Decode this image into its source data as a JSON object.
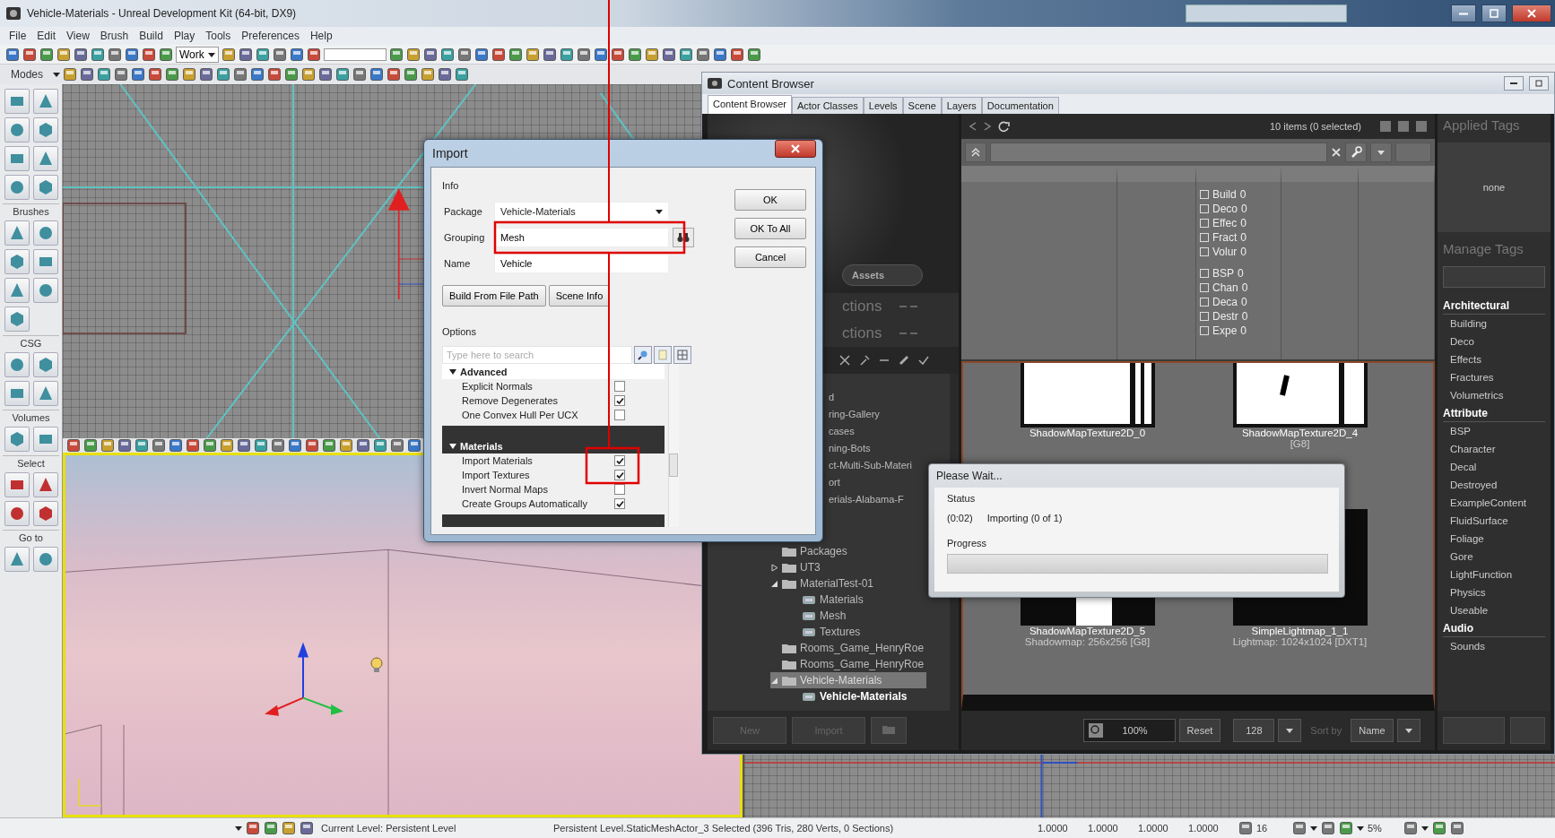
{
  "main_window": {
    "title": "Vehicle-Materials - Unreal Development Kit (64-bit, DX9)"
  },
  "menu": [
    "File",
    "Edit",
    "View",
    "Brush",
    "Build",
    "Play",
    "Tools",
    "Preferences",
    "Help"
  ],
  "toolbar": {
    "layout": "Work"
  },
  "modes_bar": {
    "label": "Modes"
  },
  "sidebar": {
    "sections": [
      "Brushes",
      "CSG",
      "Volumes",
      "Select",
      "Go to"
    ]
  },
  "content_browser": {
    "title": "Content Browser",
    "tabs": [
      {
        "label": "Content Browser",
        "selected": true
      },
      {
        "label": "Actor Classes",
        "selected": false
      },
      {
        "label": "Levels",
        "selected": false
      },
      {
        "label": "Scene",
        "selected": false
      },
      {
        "label": "Layers",
        "selected": false
      },
      {
        "label": "Documentation",
        "selected": false
      }
    ],
    "sources": {
      "assets_button": "Assets",
      "collection_headers": [
        "ctions",
        "ctions"
      ],
      "covered_items": [
        "d",
        "ring-Gallery",
        "cases",
        "ning-Bots",
        "ct-Multi-Sub-Materi",
        "ort",
        "erials-Alabama-F"
      ],
      "tree": [
        {
          "label": "Packages",
          "selected": false,
          "current": false
        },
        {
          "label": "UT3",
          "expanded": false,
          "selected": false,
          "current": false
        },
        {
          "label": "MaterialTest-01",
          "expanded": true,
          "selected": false,
          "current": false,
          "children": [
            {
              "label": "Materials",
              "selected": false,
              "current": false
            },
            {
              "label": "Mesh",
              "selected": false,
              "current": false
            },
            {
              "label": "Textures",
              "selected": false,
              "current": false
            }
          ]
        },
        {
          "label": "Rooms_Game_HenryRoe",
          "selected": false,
          "current": false
        },
        {
          "label": "Rooms_Game_HenryRoe",
          "selected": false,
          "current": false
        },
        {
          "label": "Vehicle-Materials",
          "expanded": true,
          "selected": true,
          "current": false,
          "children": [
            {
              "label": "Vehicle-Materials",
              "selected": false,
              "current": true
            }
          ]
        }
      ],
      "buttons": [
        "New",
        "Import"
      ]
    },
    "assets": {
      "count": "10 items (0 selected)",
      "tag_groups": [
        {
          "items": [
            {
              "label": "Build",
              "count": "0",
              "checked": false
            },
            {
              "label": "Deco",
              "count": "0",
              "checked": false
            },
            {
              "label": "Effec",
              "count": "0",
              "checked": false
            },
            {
              "label": "Fract",
              "count": "0",
              "checked": false
            },
            {
              "label": "Volur",
              "count": "0",
              "checked": false
            }
          ]
        },
        {
          "items": [
            {
              "label": "BSP",
              "count": "0",
              "checked": false
            },
            {
              "label": "Chan",
              "count": "0",
              "checked": false
            },
            {
              "label": "Deca",
              "count": "0",
              "checked": false
            },
            {
              "label": "Destr",
              "count": "0",
              "checked": false
            },
            {
              "label": "Expe",
              "count": "0",
              "checked": false
            }
          ]
        }
      ],
      "thumbnails": [
        {
          "name": "ShadowMapTexture2D_0"
        },
        {
          "name": "ShadowMapTexture2D_4",
          "info": "[G8]"
        },
        {
          "name": "ShadowMapTexture2D_5",
          "info": "Shadowmap: 256x256 [G8]"
        },
        {
          "name": "SimpleLightmap_1_1",
          "info": "Lightmap: 1024x1024 [DXT1]"
        }
      ],
      "zoom": "100%",
      "reset": "Reset",
      "thumb_size": "128",
      "sort_label": "Sort by",
      "sort_value": "Name"
    },
    "tags": {
      "applied_title": "Applied Tags",
      "applied_value": "none",
      "manage_title": "Manage Tags",
      "groups": [
        {
          "title": "Architectural",
          "tags": [
            "Building",
            "Deco",
            "Effects",
            "Fractures",
            "Volumetrics"
          ]
        },
        {
          "title": "Attribute",
          "tags": [
            "BSP",
            "Character",
            "Decal",
            "Destroyed",
            "ExampleContent",
            "FluidSurface",
            "Foliage",
            "Gore",
            "LightFunction",
            "Physics",
            "Useable"
          ]
        },
        {
          "title": "Audio",
          "tags": [
            "Sounds"
          ]
        }
      ]
    }
  },
  "import_dialog": {
    "title": "Import",
    "info_label": "Info",
    "fields": [
      {
        "label": "Package",
        "kind": "dropdown",
        "value": "Vehicle-Materials"
      },
      {
        "label": "Grouping",
        "kind": "text",
        "value": "Mesh"
      },
      {
        "label": "Name",
        "kind": "text",
        "value": "Vehicle"
      }
    ],
    "actions": [
      "OK",
      "OK To All",
      "Cancel"
    ],
    "path_buttons": [
      "Build From File Path",
      "Scene Info"
    ],
    "options_label": "Options",
    "search_placeholder": "Type here to search",
    "categories": [
      {
        "title": "Advanced",
        "expanded": true,
        "options": [
          {
            "label": "Explicit Normals",
            "checked": false
          },
          {
            "label": "Remove Degenerates",
            "checked": true
          },
          {
            "label": "One Convex Hull Per UCX",
            "checked": false
          }
        ]
      },
      {
        "title": "Materials",
        "expanded": true,
        "options": [
          {
            "label": "Import Materials",
            "checked": true
          },
          {
            "label": "Import Textures",
            "checked": true
          },
          {
            "label": "Invert Normal Maps",
            "checked": false
          },
          {
            "label": "Create Groups Automatically",
            "checked": true
          }
        ]
      }
    ]
  },
  "wait_dialog": {
    "title": "Please Wait...",
    "status_label": "Status",
    "elapsed": "(0:02)",
    "message": "Importing (0 of 1)",
    "progress_label": "Progress",
    "level": 0
  },
  "status_bar": {
    "current_level": "Current Level: Persistent Level",
    "selection": "Persistent Level.StaticMeshActor_3 Selected (396 Tris, 280 Verts, 0 Sections)",
    "scales": [
      "1.0000",
      "1.0000",
      "1.0000",
      "1.0000"
    ],
    "grid_size": "16",
    "scale_snap": "5%"
  }
}
